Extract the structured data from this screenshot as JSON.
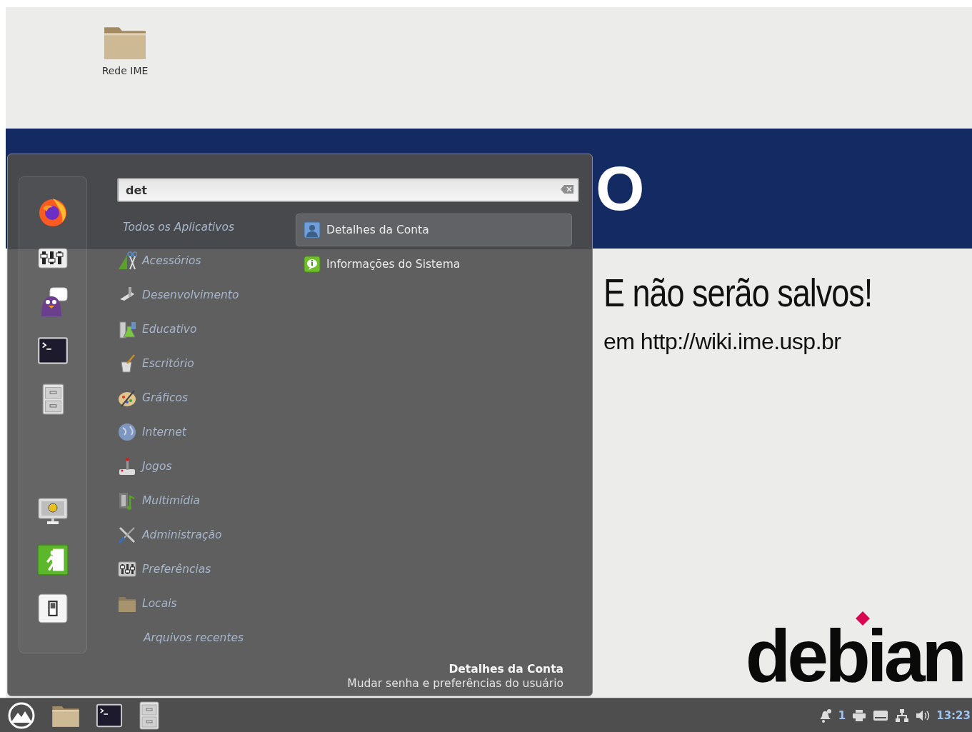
{
  "desktop_icons": [
    {
      "label": "Rede IME"
    }
  ],
  "wallpaper": {
    "heading": "O",
    "warning": "E não serão salvos!",
    "info": "em http://wiki.ime.usp.br",
    "brand": "debian"
  },
  "menu": {
    "search": {
      "value": "det"
    },
    "categories": [
      {
        "label": "Todos os Aplicativos",
        "kind": "all"
      },
      {
        "label": "Acessórios",
        "kind": "category"
      },
      {
        "label": "Desenvolvimento",
        "kind": "category"
      },
      {
        "label": "Educativo",
        "kind": "category"
      },
      {
        "label": "Escritório",
        "kind": "category"
      },
      {
        "label": "Gráficos",
        "kind": "category"
      },
      {
        "label": "Internet",
        "kind": "category"
      },
      {
        "label": "Jogos",
        "kind": "category"
      },
      {
        "label": "Multimídia",
        "kind": "category"
      },
      {
        "label": "Administração",
        "kind": "category"
      },
      {
        "label": "Preferências",
        "kind": "category"
      },
      {
        "label": "Locais",
        "kind": "category"
      },
      {
        "label": "Arquivos recentes",
        "kind": "recent"
      }
    ],
    "results": [
      {
        "label": "Detalhes da Conta",
        "selected": true
      },
      {
        "label": "Informações do Sistema",
        "selected": false
      }
    ],
    "description": {
      "title": "Detalhes da Conta",
      "subtitle": "Mudar senha e preferências do usuário"
    }
  },
  "taskbar": {
    "notifications": "1",
    "clock": "13:23"
  }
}
